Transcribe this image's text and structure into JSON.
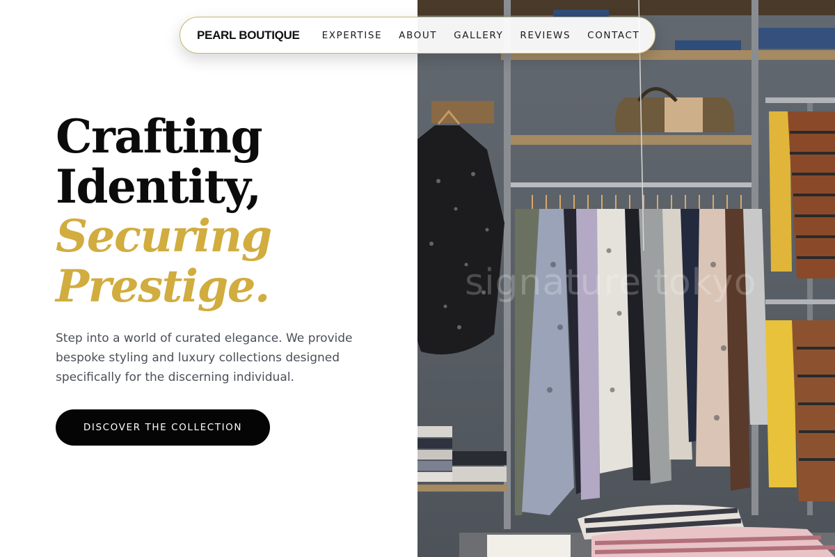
{
  "nav": {
    "brand": "PEARL BOUTIQUE",
    "links": [
      "EXPERTISE",
      "ABOUT",
      "GALLERY",
      "REVIEWS",
      "CONTACT"
    ]
  },
  "hero": {
    "title_line1": "Crafting",
    "title_line2": "Identity,",
    "title_line3": "Securing",
    "title_line4": "Prestige.",
    "description": "Step into a world of curated elegance. We provide bespoke styling and luxury collections designed specifically for the discerning individual.",
    "cta_label": "DISCOVER THE COLLECTION"
  },
  "photo": {
    "watermark": "signature tokyo",
    "subject": "clothing-rack-photo"
  },
  "colors": {
    "accent_gold": "#d1ac3f",
    "text_dark": "#0b0b0b",
    "body_gray": "#4a4f58",
    "button_black": "#050505",
    "nav_border": "#c9b46a"
  }
}
